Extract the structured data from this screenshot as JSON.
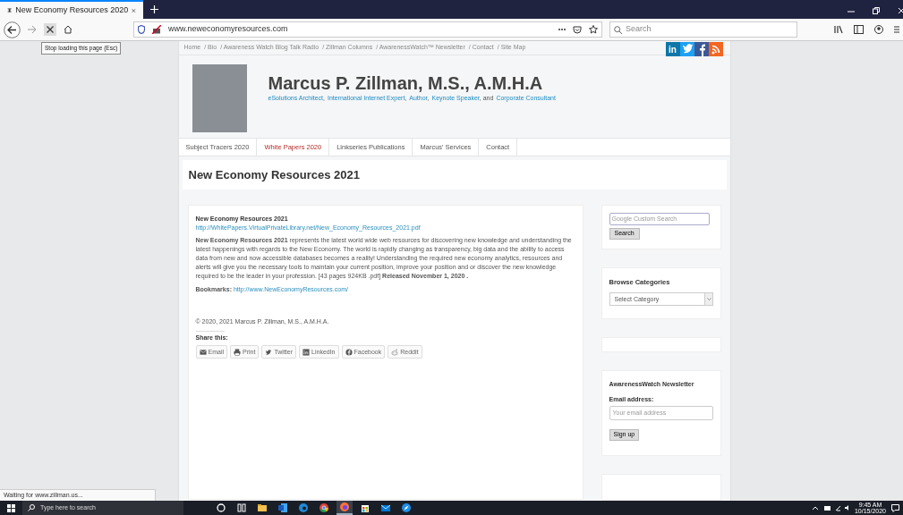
{
  "browser": {
    "tab_title": "New Economy Resources 2020",
    "url": "www.neweconomyresources.com",
    "search_placeholder": "Search",
    "tooltip": "Stop loading this page (Esc)",
    "status": "Waiting for www.zillman.us..."
  },
  "site": {
    "breadcrumb": [
      "Home",
      "/ Bio",
      "/ Awareness Watch Blog Talk Radio",
      "/ Zillman Columns",
      "/ AwarenessWatch™ Newsletter",
      "/ Contact",
      "/ Site Map"
    ],
    "social": [
      {
        "kind": "linkedin",
        "color": "#0e76a8",
        "text": "in"
      },
      {
        "kind": "twitter",
        "color": "#1da1f2"
      },
      {
        "kind": "facebook",
        "color": "#3b5998"
      },
      {
        "kind": "rss",
        "color": "#f26522"
      }
    ],
    "name": "Marcus P. Zillman, M.S., A.M.H.A",
    "tagline": [
      {
        "link": "eSolutions Architect",
        "after": ","
      },
      {
        "link": "International Internet Expert",
        "after": ","
      },
      {
        "link": "Author",
        "after": ","
      },
      {
        "link": "Keynote Speaker",
        "after": ", and"
      },
      {
        "link": "Corporate Consultant"
      }
    ],
    "menu": [
      {
        "label": "Subject Tracers 2020",
        "selected": false
      },
      {
        "label": "White Papers 2020",
        "selected": true
      },
      {
        "label": "Linkseries Publications",
        "selected": false
      },
      {
        "label": "Marcus' Services",
        "selected": false
      },
      {
        "label": "Contact",
        "selected": false
      }
    ],
    "page_title": "New Economy Resources 2021"
  },
  "article": {
    "title": "New Economy Resources 2021",
    "url": "http://WhitePapers.VirtualPrivateLibrary.net/New_Economy_Resources_2021.pdf",
    "body": "**New Economy Resources 2021** represents the latest world wide web resources for discovering new knowledge and understanding the latest happenings with regards to the New Economy. The world is rapidly changing as transparency, big data and the ability to access data from new and now accessible databases becomes a reality! Understanding the required new economy analytics, resources and alerts will give you the necessary tools to maintain your current position, improve your position and or discover the new knowledge required to be the leader in your profession. [43 pages  924KB .pdf]  **Released November 1, 2020 .**",
    "bookmarks_label": "Bookmarks:",
    "bookmarks_url": "http://www.NewEconomyResources.com/",
    "copyright": "© 2020, 2021 Marcus P. Zillman, M.S., A.M.H.A.",
    "share_label": "Share this:",
    "share": [
      {
        "kind": "email",
        "label": "Email"
      },
      {
        "kind": "print",
        "label": "Print"
      },
      {
        "kind": "twitter",
        "label": "Twitter"
      },
      {
        "kind": "linkedin",
        "label": "LinkedIn"
      },
      {
        "kind": "facebook",
        "label": "Facebook"
      },
      {
        "kind": "reddit",
        "label": "Reddit"
      }
    ]
  },
  "sidebar": {
    "search_placeholder": "Google  Custom Search",
    "search_button": "Search",
    "categories_heading": "Browse Categories",
    "category_select": "Select Category",
    "newsletter_heading": "AwarenessWatch Newsletter",
    "email_label": "Email address:",
    "email_placeholder": "Your email address",
    "signup_button": "Sign up"
  },
  "taskbar": {
    "search_placeholder": "Type here to search",
    "time": "9:45 AM",
    "date": "10/15/2020",
    "apps": [
      {
        "kind": "cortana",
        "selected": false
      },
      {
        "kind": "taskview",
        "selected": false
      },
      {
        "kind": "explorer",
        "selected": false
      },
      {
        "kind": "word",
        "selected": false
      },
      {
        "kind": "edge",
        "selected": false
      },
      {
        "kind": "chrome",
        "selected": false
      },
      {
        "kind": "firefox",
        "selected": true
      },
      {
        "kind": "store",
        "selected": false
      },
      {
        "kind": "mail",
        "selected": false
      },
      {
        "kind": "safari",
        "selected": false
      }
    ]
  }
}
